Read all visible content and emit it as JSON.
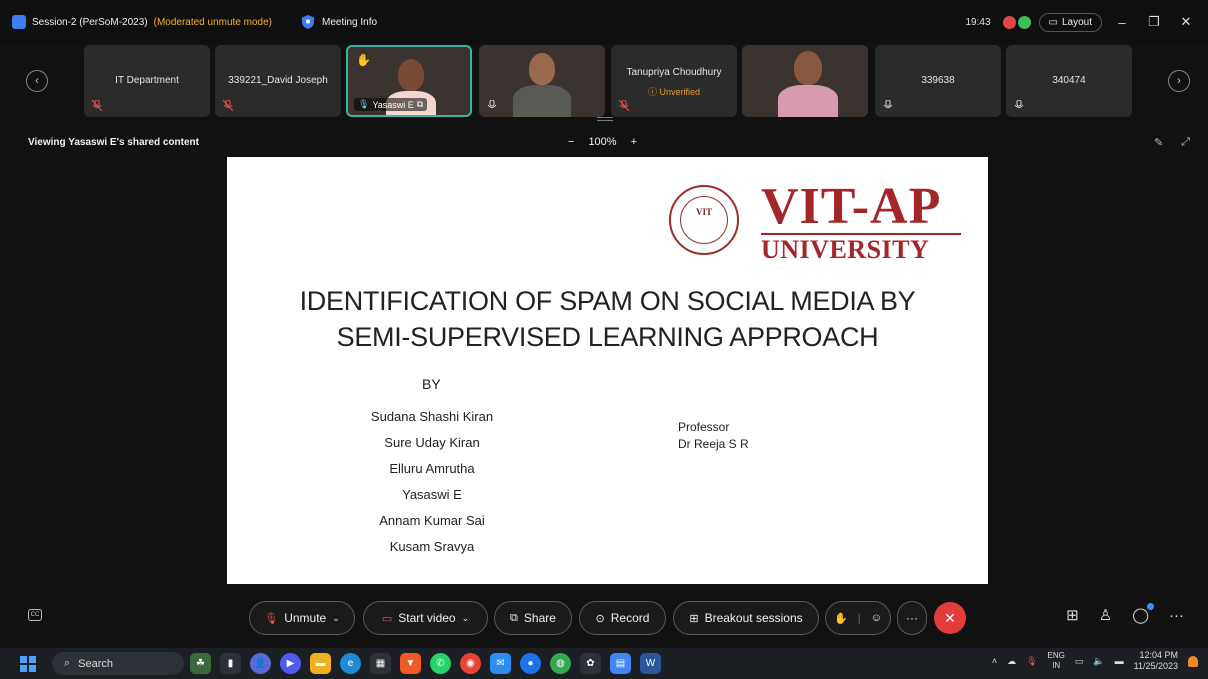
{
  "window": {
    "title": "Session-2 (PerSoM-2023)",
    "mode": "(Moderated unmute mode)",
    "meeting_info": "Meeting Info",
    "time": "19:43",
    "layout_label": "Layout"
  },
  "participants": [
    {
      "name": "IT Department",
      "muted": true
    },
    {
      "name": "339221_David Joseph",
      "muted": true
    },
    {
      "name": "Yasaswi E",
      "video": true
    },
    {
      "name": "",
      "video": true
    },
    {
      "name": "Tanupriya Choudhury",
      "status": "Unverified",
      "muted": true
    },
    {
      "name": "",
      "video": true
    },
    {
      "name": "339638",
      "muted": true
    },
    {
      "name": "340474",
      "muted": true
    }
  ],
  "viewbar": {
    "viewing_text": "Viewing Yasaswi E's shared content",
    "zoom_minus": "−",
    "zoom_level": "100%",
    "zoom_plus": "+"
  },
  "slide": {
    "logo_top": "VIT-AP",
    "logo_bottom": "UNIVERSITY",
    "seal_text": "VIT",
    "title_line1": "IDENTIFICATION OF SPAM ON SOCIAL MEDIA BY",
    "title_line2": "SEMI-SUPERVISED LEARNING APPROACH",
    "by": "BY",
    "authors": [
      "Sudana Shashi Kiran",
      "Sure Uday Kiran",
      "Elluru Amrutha",
      "Yasaswi E",
      "Annam Kumar Sai",
      "Kusam Sravya"
    ],
    "prof_role": "Professor",
    "prof_name": "Dr Reeja S R"
  },
  "controls": {
    "unmute": "Unmute",
    "start_video": "Start video",
    "share": "Share",
    "record": "Record",
    "breakout": "Breakout sessions",
    "more": "···"
  },
  "taskbar": {
    "search": "Search",
    "lang_top": "ENG",
    "lang_bottom": "IN",
    "time": "12:04 PM",
    "date": "11/25/2023"
  },
  "colors": {
    "brand_red": "#a3262b",
    "active_border": "#3fb3a5",
    "end_red": "#e33c3c",
    "mode_orange": "#f0b030"
  }
}
